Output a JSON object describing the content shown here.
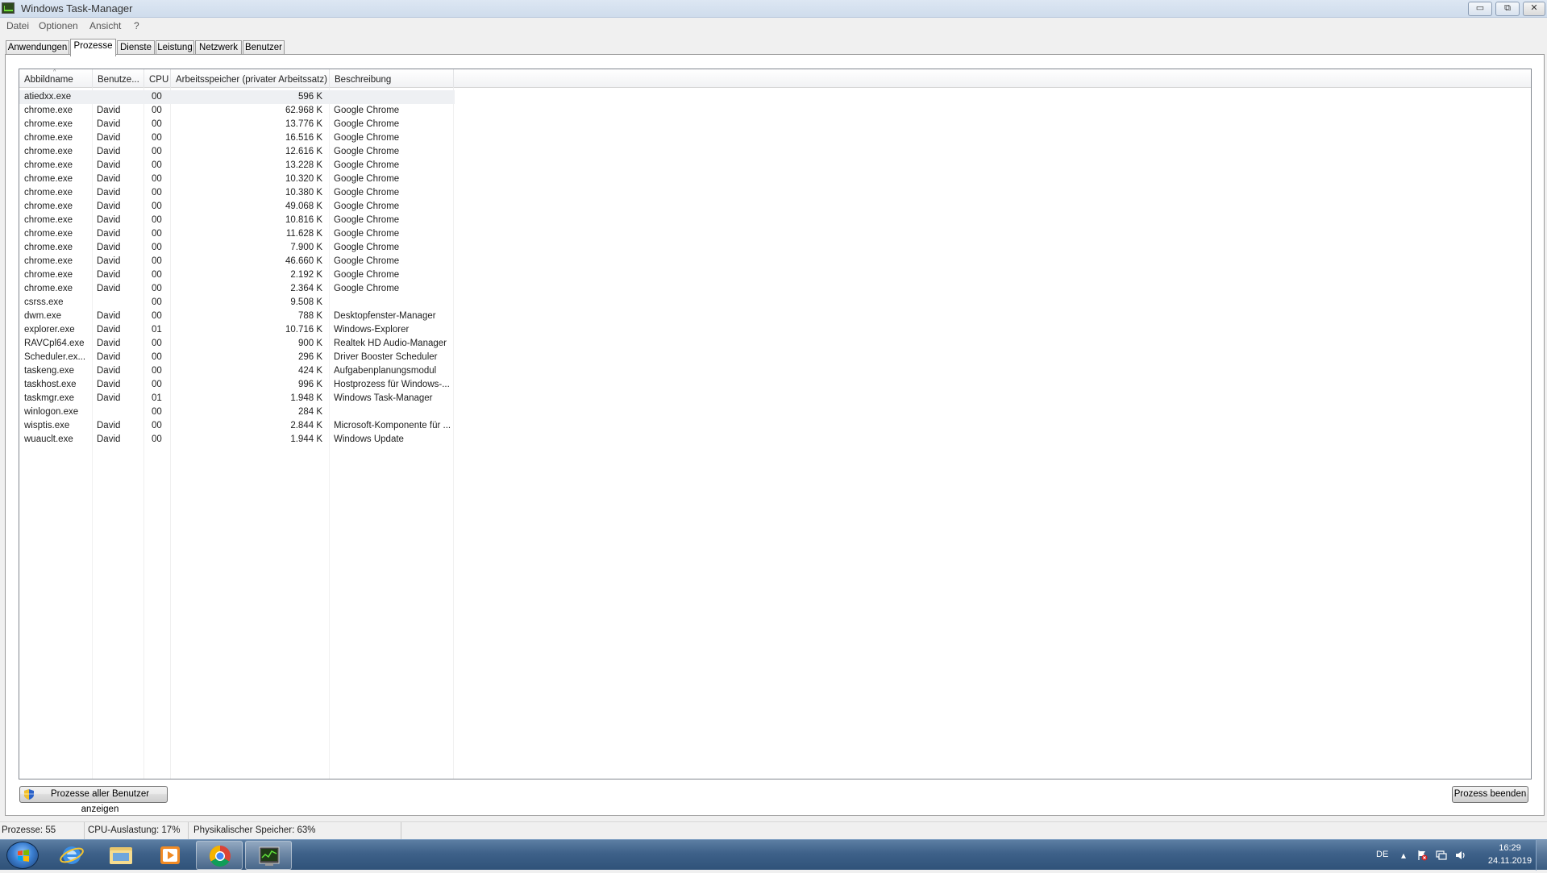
{
  "window": {
    "title": "Windows Task-Manager",
    "minimize": "▭",
    "restore": "⧉",
    "close": "✕"
  },
  "menu": [
    "Datei",
    "Optionen",
    "Ansicht",
    "?"
  ],
  "tabs": [
    {
      "label": "Anwendungen",
      "active": false
    },
    {
      "label": "Prozesse",
      "active": true
    },
    {
      "label": "Dienste",
      "active": false
    },
    {
      "label": "Leistung",
      "active": false
    },
    {
      "label": "Netzwerk",
      "active": false
    },
    {
      "label": "Benutzer",
      "active": false
    }
  ],
  "columns": {
    "name": "Abbildname",
    "user": "Benutze...",
    "cpu": "CPU",
    "mem": "Arbeitsspeicher (privater Arbeitssatz)",
    "desc": "Beschreibung"
  },
  "processes": [
    {
      "name": "atiedxx.exe",
      "user": "",
      "cpu": "00",
      "mem": "596 K",
      "desc": ""
    },
    {
      "name": "chrome.exe",
      "user": "David",
      "cpu": "00",
      "mem": "62.968 K",
      "desc": "Google Chrome"
    },
    {
      "name": "chrome.exe",
      "user": "David",
      "cpu": "00",
      "mem": "13.776 K",
      "desc": "Google Chrome"
    },
    {
      "name": "chrome.exe",
      "user": "David",
      "cpu": "00",
      "mem": "16.516 K",
      "desc": "Google Chrome"
    },
    {
      "name": "chrome.exe",
      "user": "David",
      "cpu": "00",
      "mem": "12.616 K",
      "desc": "Google Chrome"
    },
    {
      "name": "chrome.exe",
      "user": "David",
      "cpu": "00",
      "mem": "13.228 K",
      "desc": "Google Chrome"
    },
    {
      "name": "chrome.exe",
      "user": "David",
      "cpu": "00",
      "mem": "10.320 K",
      "desc": "Google Chrome"
    },
    {
      "name": "chrome.exe",
      "user": "David",
      "cpu": "00",
      "mem": "10.380 K",
      "desc": "Google Chrome"
    },
    {
      "name": "chrome.exe",
      "user": "David",
      "cpu": "00",
      "mem": "49.068 K",
      "desc": "Google Chrome"
    },
    {
      "name": "chrome.exe",
      "user": "David",
      "cpu": "00",
      "mem": "10.816 K",
      "desc": "Google Chrome"
    },
    {
      "name": "chrome.exe",
      "user": "David",
      "cpu": "00",
      "mem": "11.628 K",
      "desc": "Google Chrome"
    },
    {
      "name": "chrome.exe",
      "user": "David",
      "cpu": "00",
      "mem": "7.900 K",
      "desc": "Google Chrome"
    },
    {
      "name": "chrome.exe",
      "user": "David",
      "cpu": "00",
      "mem": "46.660 K",
      "desc": "Google Chrome"
    },
    {
      "name": "chrome.exe",
      "user": "David",
      "cpu": "00",
      "mem": "2.192 K",
      "desc": "Google Chrome"
    },
    {
      "name": "chrome.exe",
      "user": "David",
      "cpu": "00",
      "mem": "2.364 K",
      "desc": "Google Chrome"
    },
    {
      "name": "csrss.exe",
      "user": "",
      "cpu": "00",
      "mem": "9.508 K",
      "desc": ""
    },
    {
      "name": "dwm.exe",
      "user": "David",
      "cpu": "00",
      "mem": "788 K",
      "desc": "Desktopfenster-Manager"
    },
    {
      "name": "explorer.exe",
      "user": "David",
      "cpu": "01",
      "mem": "10.716 K",
      "desc": "Windows-Explorer"
    },
    {
      "name": "RAVCpl64.exe",
      "user": "David",
      "cpu": "00",
      "mem": "900 K",
      "desc": "Realtek HD Audio-Manager"
    },
    {
      "name": "Scheduler.ex...",
      "user": "David",
      "cpu": "00",
      "mem": "296 K",
      "desc": "Driver Booster Scheduler"
    },
    {
      "name": "taskeng.exe",
      "user": "David",
      "cpu": "00",
      "mem": "424 K",
      "desc": "Aufgabenplanungsmodul"
    },
    {
      "name": "taskhost.exe",
      "user": "David",
      "cpu": "00",
      "mem": "996 K",
      "desc": "Hostprozess für Windows-..."
    },
    {
      "name": "taskmgr.exe",
      "user": "David",
      "cpu": "01",
      "mem": "1.948 K",
      "desc": "Windows Task-Manager"
    },
    {
      "name": "winlogon.exe",
      "user": "",
      "cpu": "00",
      "mem": "284 K",
      "desc": ""
    },
    {
      "name": "wisptis.exe",
      "user": "David",
      "cpu": "00",
      "mem": "2.844 K",
      "desc": "Microsoft-Komponente für ..."
    },
    {
      "name": "wuauclt.exe",
      "user": "David",
      "cpu": "00",
      "mem": "1.944 K",
      "desc": "Windows Update"
    }
  ],
  "buttons": {
    "show_all": "Prozesse aller Benutzer anzeigen",
    "end_process": "Prozess beenden"
  },
  "status": {
    "processes": "Prozesse: 55",
    "cpu": "CPU-Auslastung: 17%",
    "memory": "Physikalischer Speicher: 63%"
  },
  "taskbar": {
    "language": "DE",
    "time": "16:29",
    "date": "24.11.2019",
    "apps": [
      "internet-explorer",
      "windows-explorer",
      "media-player",
      "chrome",
      "task-manager"
    ]
  },
  "colors": {
    "selection": "#eef0f3",
    "taskbar": "#3e6189"
  }
}
